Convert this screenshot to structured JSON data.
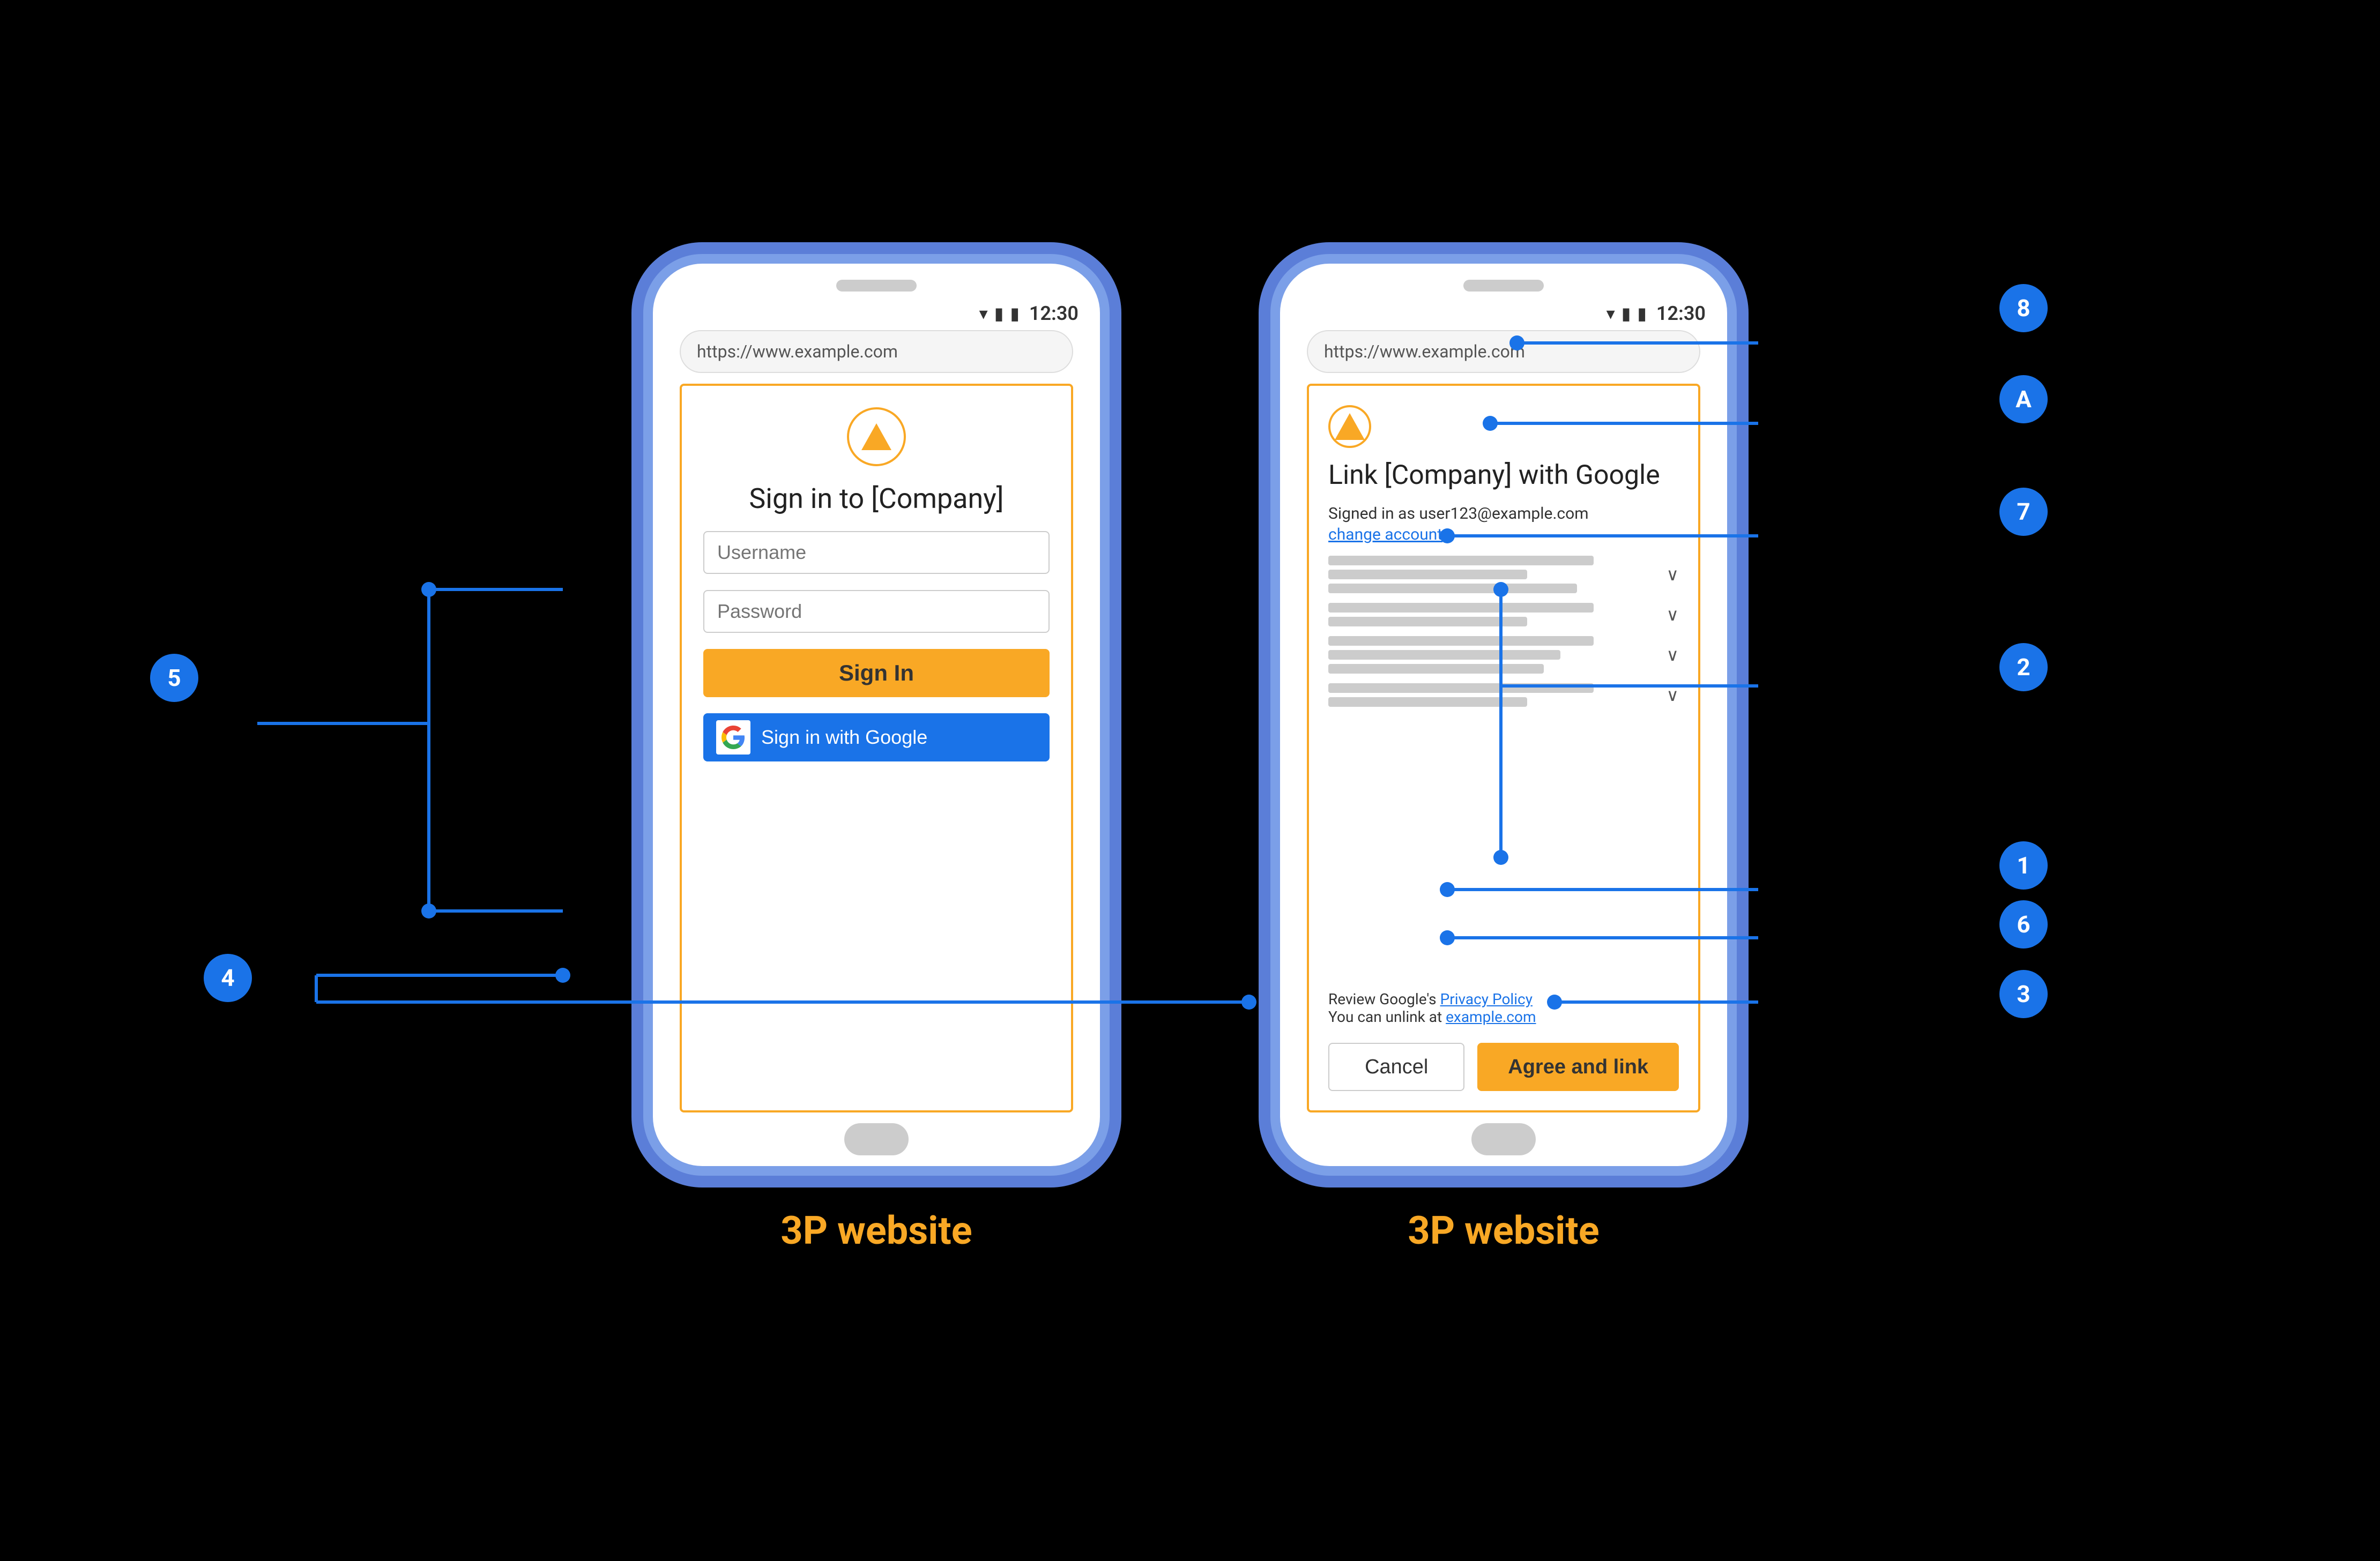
{
  "diagram": {
    "background": "#000000",
    "phones": [
      {
        "id": "phone-left",
        "label": "3P website",
        "speaker_visible": true,
        "status_bar": {
          "wifi_icon": "▾",
          "signal_icon": "▮",
          "battery_icon": "▮",
          "time": "12:30"
        },
        "browser_url": "https://www.example.com",
        "screen_type": "signin",
        "logo_shape": "triangle",
        "title": "Sign in to [Company]",
        "username_placeholder": "Username",
        "password_placeholder": "Password",
        "signin_button_label": "Sign In",
        "google_signin_label": "Sign in with Google",
        "home_indicator": true
      },
      {
        "id": "phone-right",
        "label": "3P website",
        "speaker_visible": true,
        "status_bar": {
          "wifi_icon": "▾",
          "signal_icon": "▮",
          "battery_icon": "▮",
          "time": "12:30"
        },
        "browser_url": "https://www.example.com",
        "screen_type": "link",
        "logo_shape": "triangle",
        "title": "Link [Company] with Google",
        "signed_in_as": "Signed in as user123@example.com",
        "change_account_label": "change account",
        "permissions": [
          {
            "bars": [
              "long",
              "medium",
              "long"
            ],
            "chevron": "∨"
          },
          {
            "bars": [
              "long",
              "medium"
            ],
            "chevron": "∨"
          },
          {
            "bars": [
              "long",
              "medium",
              "long"
            ],
            "chevron": "∨"
          },
          {
            "bars": [
              "long",
              "medium"
            ],
            "chevron": "∨"
          }
        ],
        "privacy_text": "Review Google's ",
        "privacy_link": "Privacy Policy",
        "unlink_text": "You can unlink at ",
        "unlink_link": "example.com",
        "cancel_label": "Cancel",
        "agree_label": "Agree and link",
        "home_indicator": true
      }
    ],
    "annotations": [
      {
        "id": "anno-1",
        "label": "1"
      },
      {
        "id": "anno-2",
        "label": "2"
      },
      {
        "id": "anno-3",
        "label": "3"
      },
      {
        "id": "anno-4",
        "label": "4"
      },
      {
        "id": "anno-5",
        "label": "5"
      },
      {
        "id": "anno-6",
        "label": "6"
      },
      {
        "id": "anno-7",
        "label": "7"
      },
      {
        "id": "anno-8",
        "label": "8"
      },
      {
        "id": "anno-A",
        "label": "A"
      }
    ]
  }
}
